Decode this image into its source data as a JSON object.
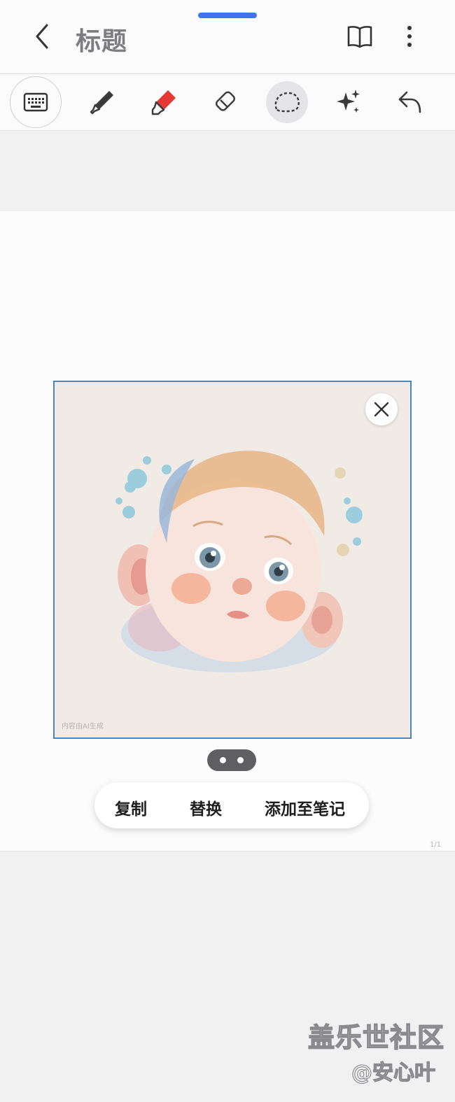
{
  "header": {
    "title": "标题"
  },
  "toolbar": {
    "tools": [
      {
        "name": "keyboard",
        "icon": "keyboard-icon"
      },
      {
        "name": "pen",
        "icon": "pen-icon"
      },
      {
        "name": "highlighter",
        "icon": "highlighter-icon"
      },
      {
        "name": "eraser",
        "icon": "eraser-icon"
      },
      {
        "name": "lasso",
        "icon": "lasso-icon",
        "selected": true
      },
      {
        "name": "ai-assist",
        "icon": "sparkle-icon"
      },
      {
        "name": "undo",
        "icon": "undo-icon"
      }
    ]
  },
  "image": {
    "watermark": "内容由AI生成"
  },
  "context_menu": {
    "copy": "复制",
    "replace": "替换",
    "add_to_note": "添加至笔记"
  },
  "page_indicator": "1/1",
  "overlay": {
    "brand": "盖乐世社区",
    "author": "@安心叶"
  },
  "colors": {
    "accent": "#3b78e7",
    "frame_border": "#4a86b8",
    "highlighter_red": "#e53935"
  }
}
